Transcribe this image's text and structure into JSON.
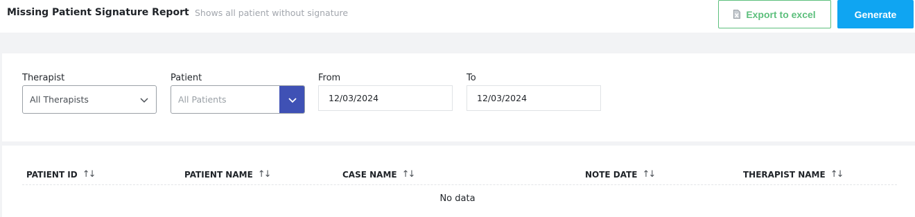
{
  "header": {
    "title": "Missing Patient Signature Report",
    "subtitle": "Shows all patient without signature",
    "export_label": "Export to excel",
    "generate_label": "Generate"
  },
  "filters": {
    "therapist": {
      "label": "Therapist",
      "value": "All Therapists"
    },
    "patient": {
      "label": "Patient",
      "placeholder": "All Patients"
    },
    "from": {
      "label": "From",
      "value": "12/03/2024"
    },
    "to": {
      "label": "To",
      "value": "12/03/2024"
    }
  },
  "table": {
    "columns": [
      "PATIENT ID",
      "PATIENT NAME",
      "CASE NAME",
      "NOTE DATE",
      "THERAPIST NAME"
    ],
    "empty_text": "No data"
  },
  "icons": {
    "export": "excel-file-icon",
    "dropdown": "chevron-down-icon",
    "sort": "sort-icon"
  },
  "colors": {
    "export": "#5cbf7c",
    "generate": "#0fa5f2",
    "patient_dropdown": "#3f51b5"
  }
}
